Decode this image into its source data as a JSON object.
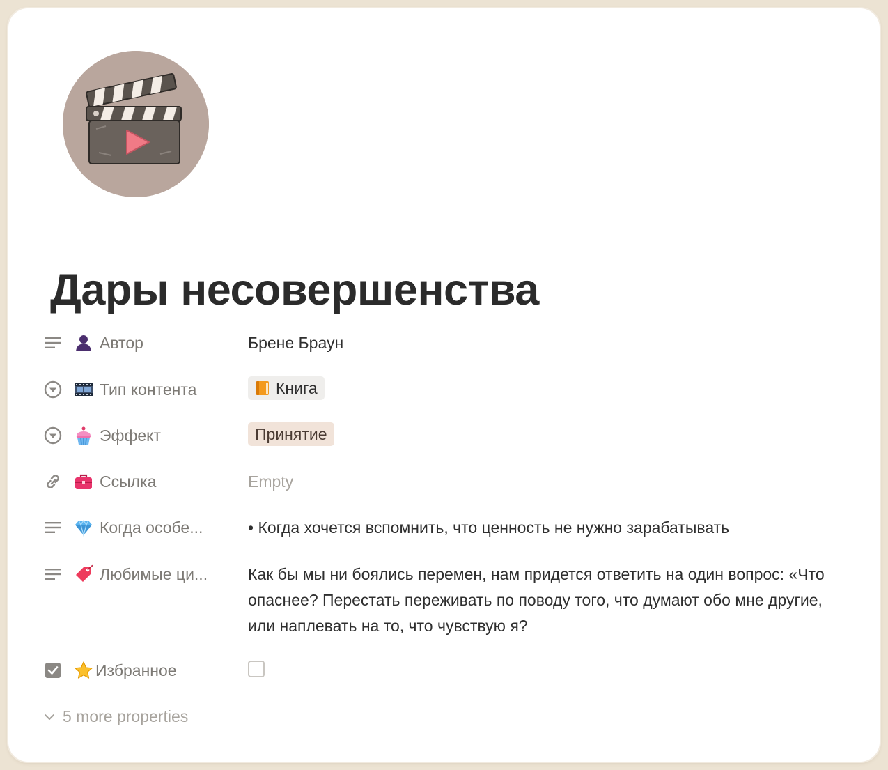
{
  "page": {
    "icon": "film-clapperboard-icon",
    "title": "Дары несовершенства"
  },
  "properties": [
    {
      "key": "author",
      "type_icon": "text-lines-icon",
      "emoji": "bust-in-silhouette-icon",
      "name": "Автор",
      "value": "Брене Браун"
    },
    {
      "key": "content_type",
      "type_icon": "select-icon",
      "emoji": "film-frames-icon",
      "name": "Тип контента",
      "value": "Книга",
      "value_emoji": "orange-book-icon",
      "value_color": "#efeeec"
    },
    {
      "key": "effect",
      "type_icon": "select-icon",
      "emoji": "cupcake-icon",
      "name": "Эффект",
      "value": "Принятие",
      "value_color": "#f1e3d9"
    },
    {
      "key": "link",
      "type_icon": "link-icon",
      "emoji": "briefcase-icon",
      "name": "Ссылка",
      "value": "Empty"
    },
    {
      "key": "when",
      "type_icon": "text-lines-icon",
      "emoji": "gem-icon",
      "name": "Когда особе...",
      "value": "• Когда хочется вспомнить, что ценность не нужно зарабатывать"
    },
    {
      "key": "quotes",
      "type_icon": "text-lines-icon",
      "emoji": "label-tag-icon",
      "name": "Любимые ци...",
      "value": "Как бы мы ни боялись перемен, нам придется ответить на один вопрос: «Что опаснее? Перестать переживать по поводу того, что думают обо мне другие, или наплевать на то, что чувствую я?"
    },
    {
      "key": "favorite",
      "type_icon": "checkbox-icon",
      "emoji": "star-icon",
      "name": "Избранное",
      "checked": false
    }
  ],
  "more_properties": "5 more properties"
}
